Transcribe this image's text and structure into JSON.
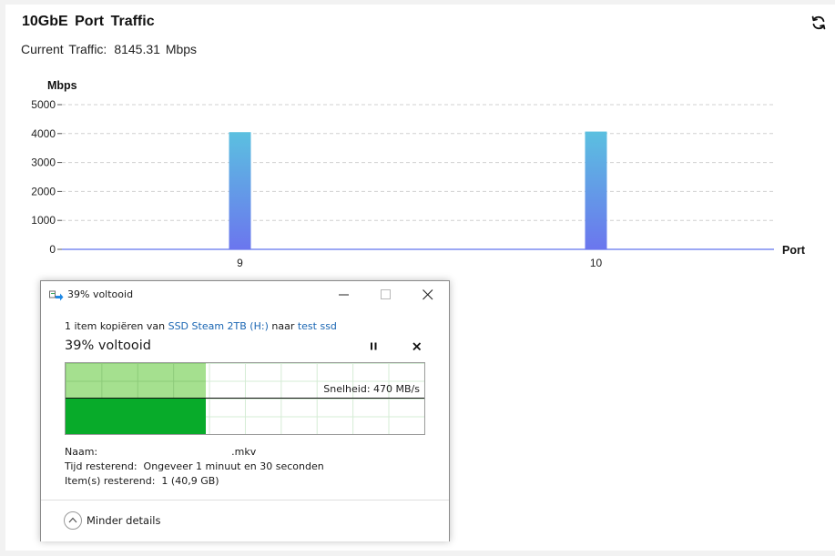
{
  "panel": {
    "title": "10GbE Port Traffic",
    "current_label": "Current Traffic:",
    "current_value": "8145.31 Mbps",
    "refresh_icon": "refresh-icon"
  },
  "chart_data": {
    "type": "bar",
    "categories": [
      "9",
      "10"
    ],
    "values": [
      4050,
      4070
    ],
    "ylabel": "Mbps",
    "xlabel": "Port",
    "ylim": [
      0,
      5000
    ],
    "yticks": [
      "0",
      "1000",
      "2000",
      "3000",
      "4000",
      "5000"
    ],
    "grid": true,
    "colors": {
      "bar_top": "#5bc0e0",
      "bar_bottom": "#6b76ee",
      "axis": "#7b8cf0",
      "grid": "#d0d0d0"
    }
  },
  "dialog": {
    "title": "39% voltooid",
    "copy_prefix": "1 item kopiëren van ",
    "source": "SSD Steam 2TB (H:)",
    "copy_mid": " naar ",
    "destination": "test ssd",
    "status": "39% voltooid",
    "progress": 0.39,
    "speed_label": "Snelheid: 470 MB/s",
    "name_label": "Naam:",
    "name_value": ".mkv",
    "time_label": "Tijd resterend:",
    "time_value": "Ongeveer 1 minuut en 30 seconden",
    "items_label": "Item(s) resterend:",
    "items_value": "1 (40,9 GB)",
    "less_details": "Minder details",
    "icons": [
      "copy-arrow-icon",
      "minimize-icon",
      "maximize-icon",
      "close-icon",
      "pause-icon",
      "cancel-icon",
      "chevron-up-icon"
    ],
    "colors": {
      "fill_light": "#a5e08f",
      "fill_dark": "#08ab2a",
      "link": "#1a66b3"
    }
  }
}
